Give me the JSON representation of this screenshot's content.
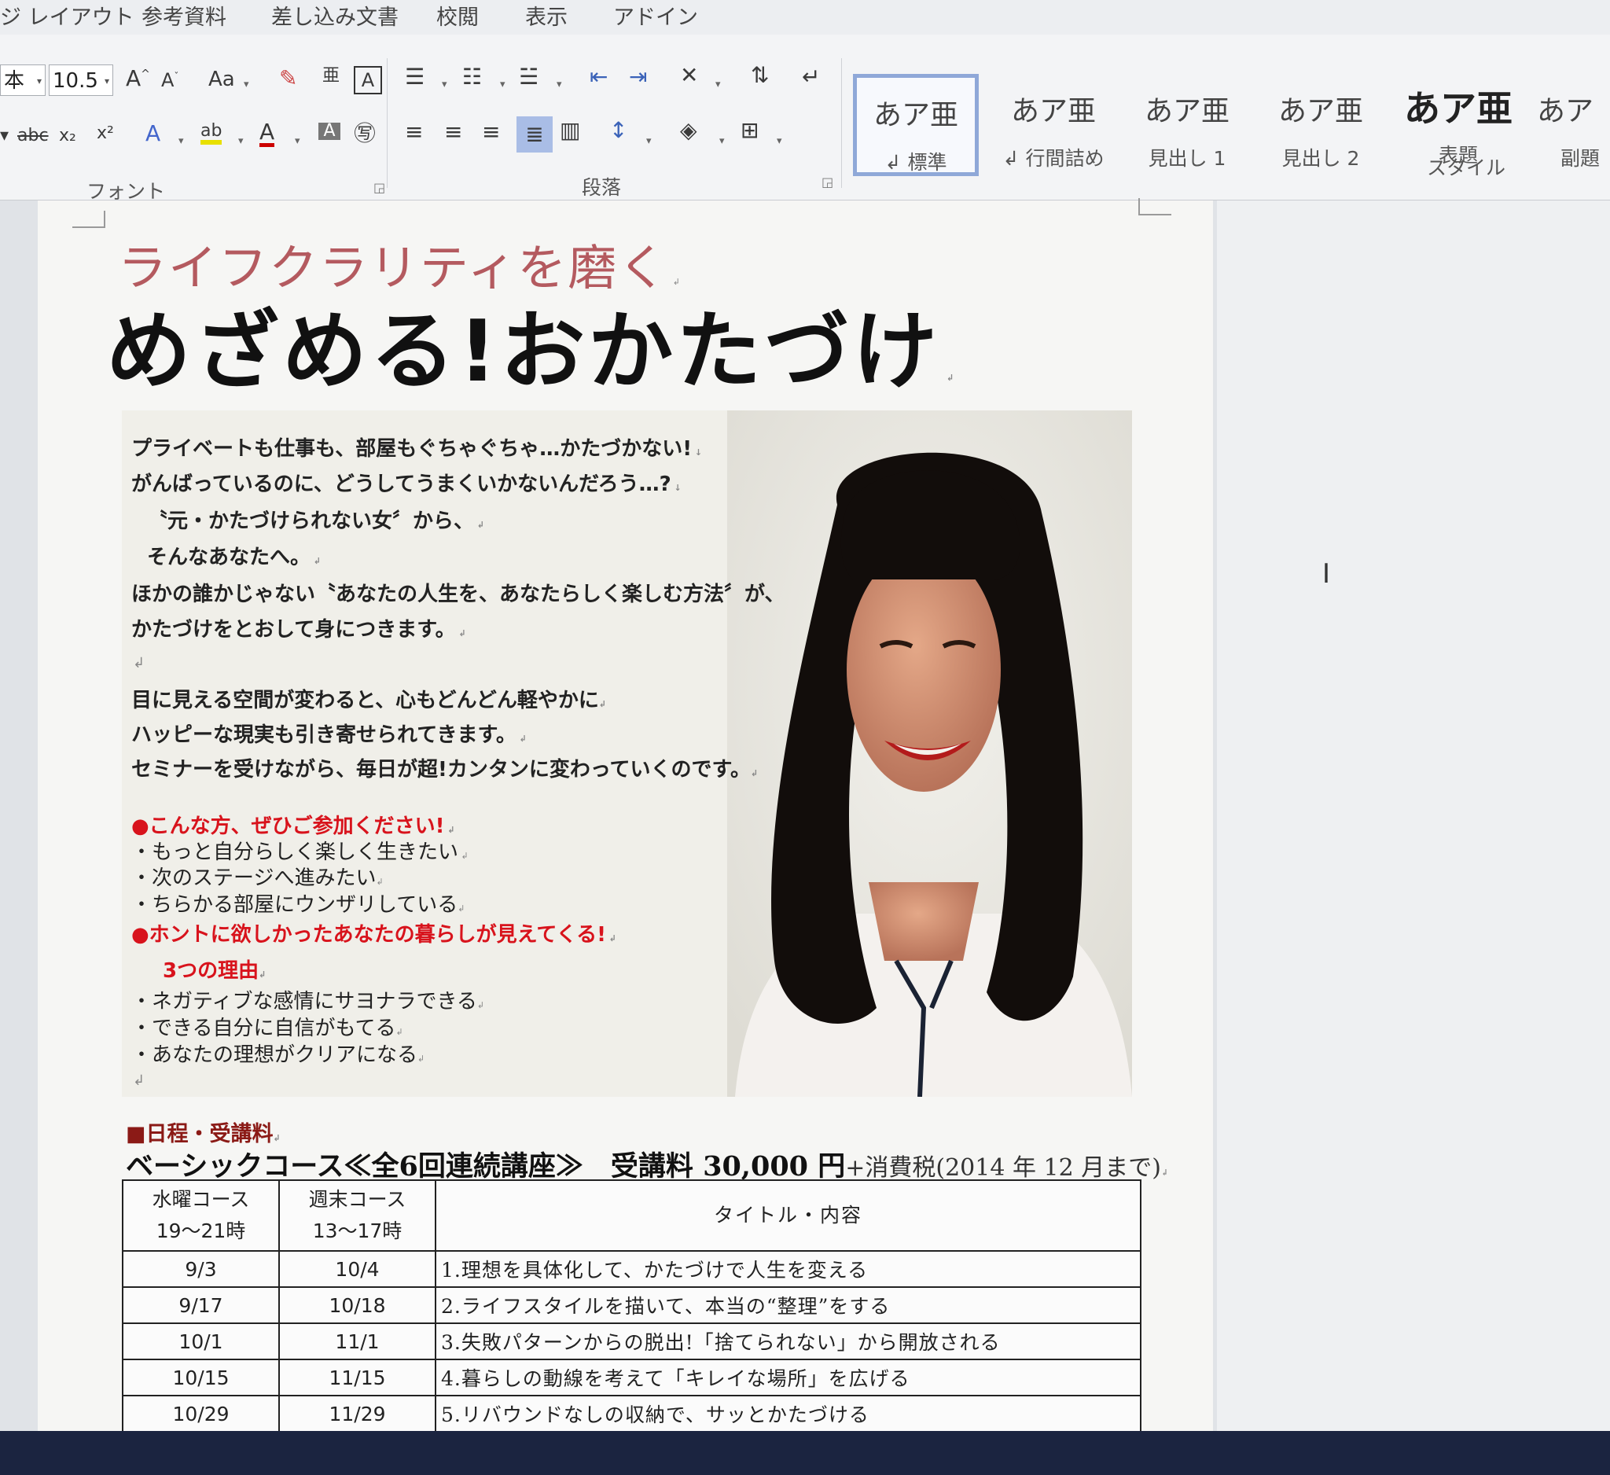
{
  "menu_tabs": [
    "ジ レイアウト",
    "参考資料",
    "差し込み文書",
    "校閲",
    "表示",
    "アドイン"
  ],
  "ribbon": {
    "font": {
      "font_name": "本",
      "font_size": "10.5",
      "grow": "A",
      "shrink": "A",
      "case": "Aa",
      "group_label": "フォント"
    },
    "paragraph": {
      "group_label": "段落"
    },
    "styles": {
      "group_label": "スタイル",
      "items": [
        {
          "sample": "あア亜",
          "name": "標準",
          "selected": true
        },
        {
          "sample": "あア亜",
          "name": "行間詰め"
        },
        {
          "sample": "あア亜",
          "name": "見出し 1"
        },
        {
          "sample": "あア亜",
          "name": "見出し 2"
        },
        {
          "sample": "あア亜",
          "name": "表題"
        },
        {
          "sample": "あア",
          "name": "副題"
        }
      ]
    }
  },
  "document": {
    "subtitle": "ライフクラリティを磨く",
    "title": "めざめる!おかたづけ",
    "intro_lines": [
      "プライベートも仕事も、部屋もぐちゃぐちゃ…かたづかない!",
      "がんばっているのに、どうしてうまくいかないんだろう…?",
      "〝元・かたづけられない女〞から、",
      "そんなあなたへ。",
      "ほかの誰かじゃない〝あなたの人生を、あなたらしく楽しむ方法〞が、",
      "かたづけをとおして身につきます。",
      "目に見える空間が変わると、心もどんどん軽やかに",
      "ハッピーな現実も引き寄せられてきます。",
      "セミナーを受けながら、毎日が超!カンタンに変わっていくのです。"
    ],
    "recommend_heading": "●こんな方、ぜひご参加ください!",
    "recommend_items": [
      "・もっと自分らしく楽しく生きたい",
      "・次のステージへ進みたい",
      "・ちらかる部屋にウンザリしている"
    ],
    "reasons_heading": "●ホントに欲しかったあなたの暮らしが見えてくる!",
    "reasons_subheading": "3つの理由",
    "reason_items": [
      "・ネガティブな感情にサヨナラできる",
      "・できる自分に自信がもてる",
      "・あなたの理想がクリアになる"
    ],
    "schedule_heading": "■日程・受講料",
    "course_title": "ベーシックコース≪全6回連続講座≫　受講料 30,000 円",
    "course_tax": "+消費税(2014 年 12 月まで)",
    "table": {
      "col1_header_line1": "水曜コース",
      "col1_header_line2": "19～21時",
      "col2_header_line1": "週末コース",
      "col2_header_line2": "13～17時",
      "col3_header": "タイトル・内容",
      "rows": [
        {
          "wed": "9/3",
          "weekend": "10/4",
          "content": "1.理想を具体化して、かたづけで人生を変える"
        },
        {
          "wed": "9/17",
          "weekend": "10/18",
          "content": "2.ライフスタイルを描いて、本当の“整理”をする"
        },
        {
          "wed": "10/1",
          "weekend": "11/1",
          "content": "3.失敗パターンからの脱出!「捨てられない」から開放される"
        },
        {
          "wed": "10/15",
          "weekend": "11/15",
          "content": "4.暮らしの動線を考えて「キレイな場所」を広げる"
        },
        {
          "wed": "10/29",
          "weekend": "11/29",
          "content": "5.リバウンドなしの収納で、サッとかたづける"
        }
      ]
    }
  }
}
